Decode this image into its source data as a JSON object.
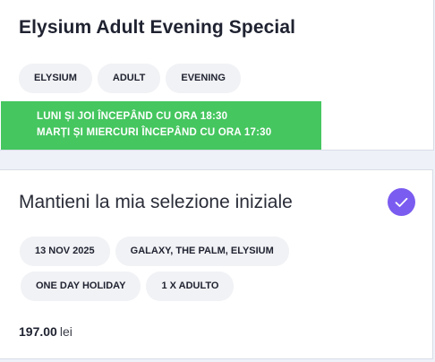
{
  "offer": {
    "title": "Elysium Adult Evening Special",
    "tags": [
      "ELYSIUM",
      "ADULT",
      "EVENING"
    ],
    "schedule": [
      "LUNI ȘI JOI ÎNCEPÂND CU ORA 18:30",
      "MARȚI ȘI MIERCURI ÎNCEPÂND CU ORA 17:30"
    ],
    "banner_color": "#45c65f"
  },
  "selection": {
    "title": "Mantieni la mia selezione iniziale",
    "checked": true,
    "check_icon": "check-icon",
    "accent_color": "#7b5cf0",
    "details_row1": [
      "13 NOV 2025",
      "GALAXY, THE PALM, ELYSIUM"
    ],
    "details_row2": [
      "ONE DAY HOLIDAY",
      "1 X ADULTO"
    ],
    "price_amount": "197.00",
    "price_currency": "lei"
  }
}
